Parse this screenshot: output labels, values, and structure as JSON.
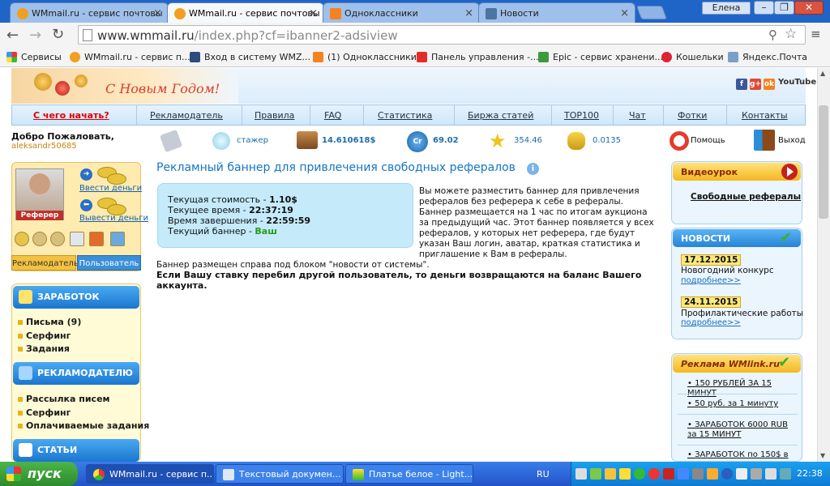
{
  "browser": {
    "tabs": [
      {
        "title": "WMmail.ru - сервис почтовы",
        "active": false
      },
      {
        "title": "WMmail.ru - сервис почтовы",
        "active": true
      },
      {
        "title": "Одноклассники",
        "active": false
      },
      {
        "title": "Новости",
        "active": false
      }
    ],
    "user": "Елена",
    "url_host": "www.wmmail.ru",
    "url_path": "/index.php?cf=ibanner2-adsiview",
    "bookmarks": [
      "Сервисы",
      "WMmail.ru - сервис п...",
      "Вход в систему WMZ...",
      "(1) Одноклассники",
      "Панель управления -...",
      "Epic - сервис хранени...",
      "Кошельки",
      "Яндекс.Почта"
    ]
  },
  "header": {
    "greeting": "С Новым Годом!",
    "youtube": "YouTube"
  },
  "menu": [
    "С чего начать?",
    "Рекламодатель",
    "Правила",
    "FAQ",
    "Статистика",
    "Биржа статей",
    "TOP100",
    "Чат",
    "Фотки",
    "Контакты"
  ],
  "status": {
    "welcome": "Добро Пожаловать,",
    "username": "aleksandr50685",
    "rank": "стажер",
    "balance": "14.610618$",
    "cr": "69.02",
    "rating": "354.46",
    "coins": "0.0135",
    "help": "Помощь",
    "logout": "Выход"
  },
  "userbox": {
    "avatar_label": "Реферер",
    "deposit": "Ввести деньги",
    "withdraw": "Вывести деньги",
    "role_advertiser": "Рекламодатель",
    "role_user": "Пользователь"
  },
  "sidebar": {
    "sections": [
      {
        "title": "ЗАРАБОТОК",
        "items": [
          "Письма (9)",
          "Серфинг",
          "Задания"
        ]
      },
      {
        "title": "РЕКЛАМОДАТЕЛЮ",
        "items": [
          "Рассылка писем",
          "Серфинг",
          "Оплачиваемые задания"
        ]
      },
      {
        "title": "СТАТЬИ",
        "items": []
      }
    ]
  },
  "main": {
    "title": "Рекламный баннер для привлечения свободных рефералов",
    "auction": {
      "price_label": "Текущая стоимость - ",
      "price_value": "1.10$",
      "time_label": "Текущее время - ",
      "time_value": "22:37:19",
      "end_label": "Время завершения - ",
      "end_value": "22:59:59",
      "banner_label": "Текущий баннер - ",
      "banner_value": "Ваш"
    },
    "description": "Вы можете разместить баннер для привлечения рефералов без реферера к себе в рефералы. Баннер размещается на 1 час по итогам аукциона за предыдущий час. Этот баннер появляется у всех рефералов, у которых нет реферера, где будут указан Ваш логин, аватар, краткая статистика и приглашение к Вам в рефералы.",
    "placed": "Баннер размещен справа под блоком \"новости от системы\".",
    "warning": "Если Вашу ставку перебил другой пользователь, то деньги возвращаются на баланс Вашего аккаунта."
  },
  "right": {
    "video_title": "Видеоурок",
    "video_link": "Свободные рефералы",
    "news_title": "НОВОСТИ",
    "news": [
      {
        "date": "17.12.2015",
        "text": "Новогодний конкурс",
        "more": "подробнее>>"
      },
      {
        "date": "24.11.2015",
        "text": "Профилактические работы",
        "more": "подробнее>>"
      }
    ],
    "ads_title": "Реклама WMlink.ru",
    "ads": [
      "• 150 РУБЛЕЙ ЗА 15 МИНУТ",
      "• 50 руб. за 1 минуту",
      "• ЗАРАБОТОК 6000 RUB за 15 МИНУТ",
      "• ЗАРАБОТОК по 150$ в"
    ]
  },
  "taskbar": {
    "start": "пуск",
    "tasks": [
      "WMmail.ru - сервис п...",
      "Текстовый докумен...",
      "Платье белое - Light..."
    ],
    "lang": "RU",
    "clock": "22:38"
  }
}
